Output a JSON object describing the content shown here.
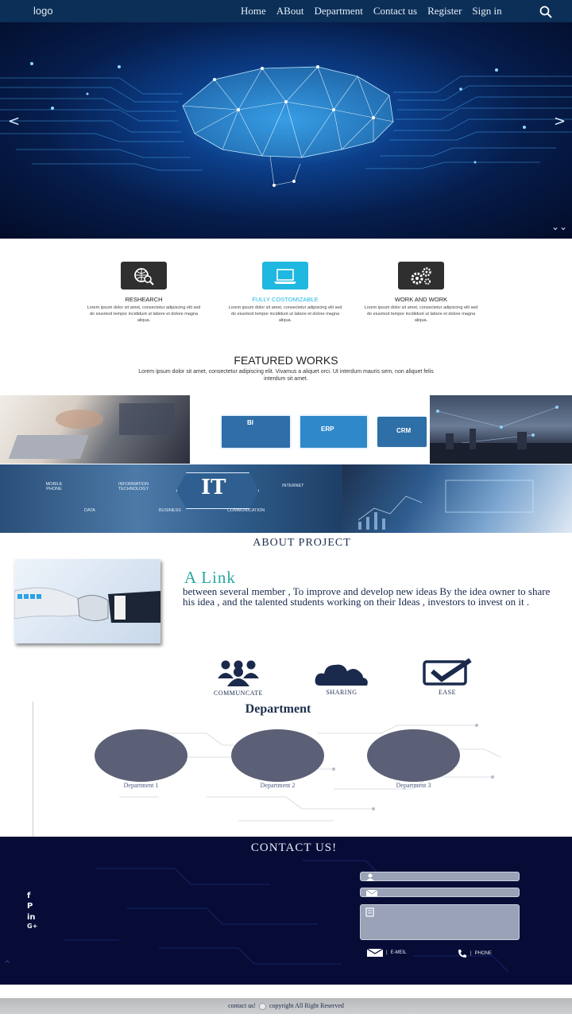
{
  "nav": {
    "logo": "logo",
    "links": [
      "Home",
      "ABout",
      "Department",
      "Contact us",
      "Register",
      "Sign in"
    ]
  },
  "hero": {
    "prev": "<",
    "next": ">",
    "scroll": "⌄⌄"
  },
  "features": [
    {
      "title": "RESHEARCH",
      "desc": "Lorem ipsum dolor sit amet, consectetur adipiscing elit sed do eiusmod tempor incididunt ut labore et dolore magna aliqua.",
      "icon": "research-icon",
      "color": "#2f2f2f"
    },
    {
      "title": "FULLY COSTOMIZABLE",
      "desc": "Lorem ipsum dolor sit amet, consectetur adipiscing elit sed do eiusmod tempor incididunt ut labore et dolore magna aliqua.",
      "icon": "laptop-icon",
      "color": "#1fb8e0"
    },
    {
      "title": "WORK AND WORK",
      "desc": "Lorem ipsum dolor sit amet, consectetur adipiscing elit sed do eiusmod tempor incididunt ut labore et dolore magna aliqua.",
      "icon": "gears-icon",
      "color": "#2f2f2f"
    }
  ],
  "featured": {
    "title": "FEATURED WORKS",
    "desc": "Lorem ipsum dolor sit amet, consectetur adipiscing elit. Vivamus a aliquet orci. Ut interdum mauris sem, non aliquet felis interdum sit amet.",
    "tile_labels": {
      "bi": "BI",
      "erp": "ERP",
      "crm": "CRM",
      "it": "IT",
      "mobile": "MOBILE PHONE",
      "infotech": "INFORMATION TECHNOLOGY",
      "internet": "INTERNET",
      "data": "DATA",
      "business": "BUSINESS",
      "communication": "COMMUNICATION"
    }
  },
  "about": {
    "title": "ABOUT PROJECT",
    "link_title": "A Link",
    "text": "between several member , To improve and develop new ideas By the idea owner to share his idea , and the talented students working on their  Ideas , investors to invest on it ."
  },
  "icons": [
    {
      "label": "COMMUNCATE",
      "icon": "group-icon"
    },
    {
      "label": "SHARING",
      "icon": "cloud-icon"
    },
    {
      "label": "EASE",
      "icon": "checkbox-icon"
    }
  ],
  "department": {
    "title": "Department",
    "items": [
      "Department 1",
      "Department 2",
      "Department 3"
    ]
  },
  "contact": {
    "title": "CONTACT US!",
    "social": [
      "f",
      "P",
      "in",
      "G+"
    ],
    "email_label": "E-MEIL",
    "phone_label": "PHONE"
  },
  "footer": {
    "left": "contact us!",
    "right": "copyright All Right Reserved"
  },
  "colors": {
    "nav_bg": "#0c2f57",
    "accent": "#1fb8e0",
    "contact_bg": "#060c36",
    "link_teal": "#29a7a0"
  }
}
